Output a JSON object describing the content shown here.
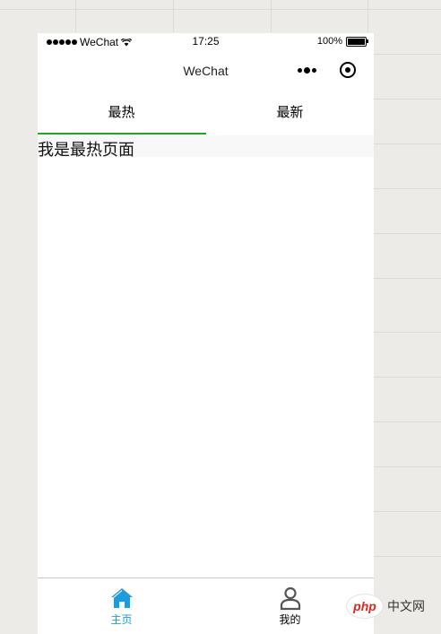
{
  "status_bar": {
    "carrier": "WeChat",
    "time": "17:25",
    "battery": "100%"
  },
  "nav": {
    "title": "WeChat"
  },
  "tabs": [
    {
      "label": "最热",
      "active": true
    },
    {
      "label": "最新",
      "active": false
    }
  ],
  "content": {
    "text": "我是最热页面"
  },
  "tabbar": {
    "items": [
      {
        "label": "主页",
        "icon": "home-icon",
        "active": true
      },
      {
        "label": "我的",
        "icon": "user-icon",
        "active": false
      }
    ]
  },
  "watermark": {
    "brand": "php",
    "suffix": "中文网"
  },
  "colors": {
    "accent_green": "#1aad19",
    "active_blue": "#1a9ce0"
  }
}
